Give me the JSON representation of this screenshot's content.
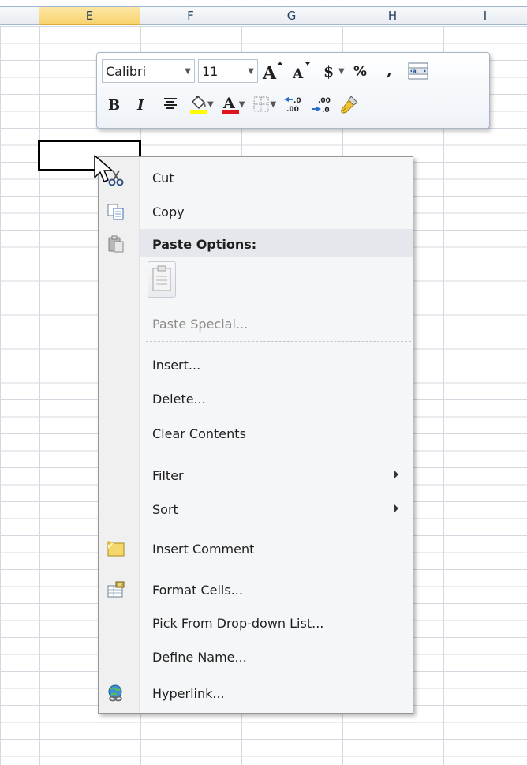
{
  "columns": [
    "E",
    "F",
    "G",
    "H",
    "I"
  ],
  "active_column": "E",
  "mini_toolbar": {
    "font_name": "Calibri",
    "font_size": "11"
  },
  "context_menu": {
    "items": [
      {
        "label": "Cut",
        "icon": "scissors-icon"
      },
      {
        "label": "Copy",
        "icon": "copy-icon"
      },
      {
        "label": "Paste Options:",
        "icon": "paste-icon"
      },
      {
        "label": "Paste Special...",
        "icon": ""
      },
      {
        "label": "Insert...",
        "icon": ""
      },
      {
        "label": "Delete...",
        "icon": ""
      },
      {
        "label": "Clear Contents",
        "icon": ""
      },
      {
        "label": "Filter",
        "icon": ""
      },
      {
        "label": "Sort",
        "icon": ""
      },
      {
        "label": "Insert Comment",
        "icon": "comment-icon"
      },
      {
        "label": "Format Cells...",
        "icon": "format-cells-icon"
      },
      {
        "label": "Pick From Drop-down List...",
        "icon": ""
      },
      {
        "label": "Define Name...",
        "icon": ""
      },
      {
        "label": "Hyperlink...",
        "icon": "hyperlink-icon"
      }
    ]
  },
  "colors": {
    "active_header": "#f9d36f",
    "menu_background": "#f5f6f7",
    "font_color_bar": "#e0141e",
    "highlight_bar": "#ffff00"
  }
}
